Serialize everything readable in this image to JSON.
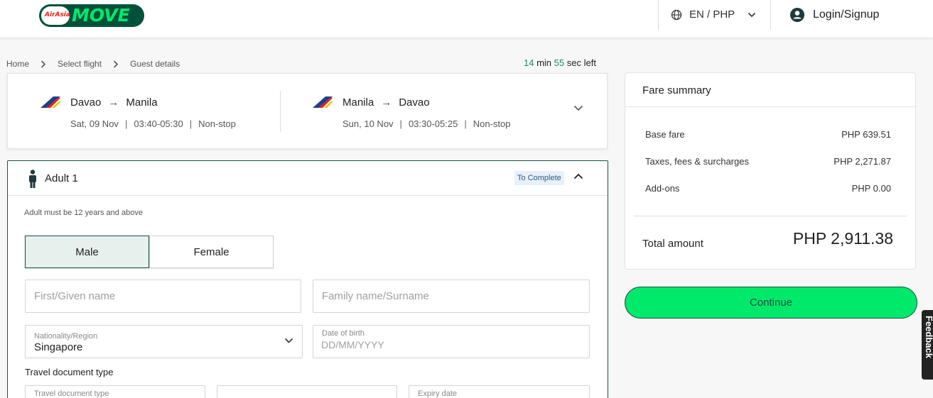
{
  "header": {
    "logo_small": "AirAsia",
    "logo_text": "MOVE",
    "language": "EN / PHP",
    "login": "Login/Signup"
  },
  "breadcrumb": [
    "Home",
    "Select flight",
    "Guest details"
  ],
  "timer": {
    "minutes": "14",
    "min_label": "min",
    "seconds": "55",
    "sec_label": "sec left"
  },
  "flights": [
    {
      "from": "Davao",
      "to": "Manila",
      "date": "Sat, 09 Nov",
      "time": "03:40-05:30",
      "stops": "Non-stop"
    },
    {
      "from": "Manila",
      "to": "Davao",
      "date": "Sun, 10 Nov",
      "time": "03:30-05:25",
      "stops": "Non-stop"
    }
  ],
  "guest": {
    "title": "Adult 1",
    "status_badge": "To Complete",
    "age_note": "Adult must be 12 years and above",
    "gender_options": [
      "Male",
      "Female"
    ],
    "selected_gender": "Male",
    "first_name_placeholder": "First/Given name",
    "family_name_placeholder": "Family name/Surname",
    "nationality_label": "Nationality/Region",
    "nationality_value": "Singapore",
    "dob_label": "Date of birth",
    "dob_placeholder": "DD/MM/YYYY",
    "doc_section_label": "Travel document type",
    "doc_type_label": "Travel document type",
    "expiry_label": "Expiry date"
  },
  "fare": {
    "title": "Fare summary",
    "rows": [
      {
        "label": "Base fare",
        "value": "PHP 639.51"
      },
      {
        "label": "Taxes, fees & surcharges",
        "value": "PHP 2,271.87"
      },
      {
        "label": "Add-ons",
        "value": "PHP 0.00"
      }
    ],
    "total_label": "Total amount",
    "total_value": "PHP 2,911.38"
  },
  "continue_label": "Continue",
  "feedback_label": "Feedback",
  "colors": {
    "brand_dark": "#1f4d47",
    "brand_green": "#00e96a",
    "airline_red": "#e2231a"
  }
}
